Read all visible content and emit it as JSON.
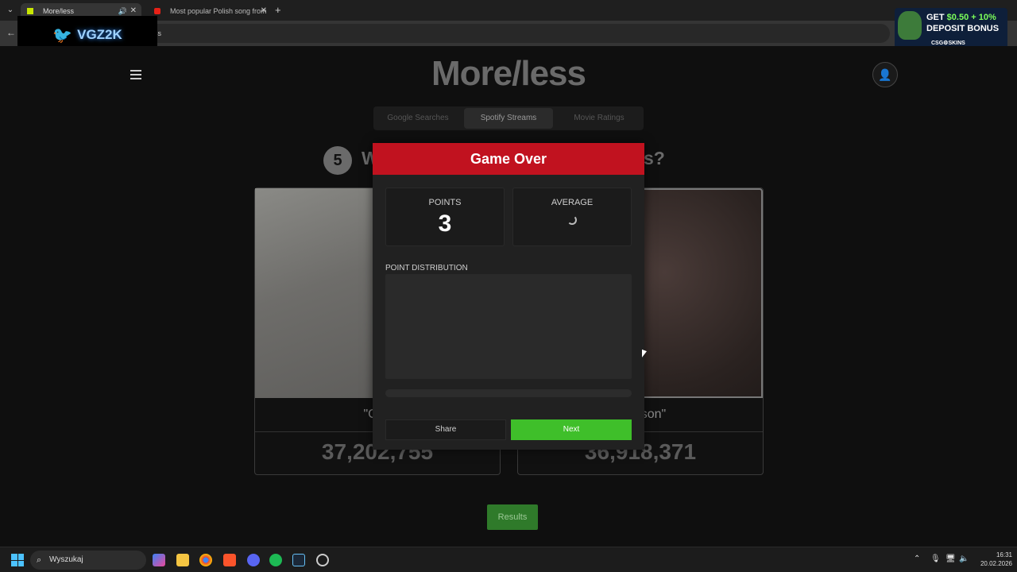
{
  "browser": {
    "tabs": [
      {
        "title": "More/less",
        "active": true
      },
      {
        "title": "Most popular Polish song from",
        "active": false
      }
    ],
    "new_tab": "+",
    "address": "ss"
  },
  "overlay": {
    "webcam_name": "VGZ2K",
    "ad": {
      "line1_prefix": "GET ",
      "line1_highlight": "$0.50 + 10%",
      "line2": "DEPOSIT BONUS",
      "brand": "CSG⚙SKINS"
    }
  },
  "site": {
    "title": "More/less",
    "categories": [
      {
        "label": "Google Searches",
        "active": false
      },
      {
        "label": "Spotify Streams",
        "active": true
      },
      {
        "label": "Movie Ratings",
        "active": false
      }
    ],
    "question_number": "5",
    "question_text_start": "W",
    "question_text_end": "ams?",
    "cards": {
      "left": {
        "name": "\"Cha",
        "value": "37,202,755"
      },
      "right": {
        "name": "Jackson\"",
        "value": "36,918,371"
      }
    },
    "results_label": "Results"
  },
  "modal": {
    "title": "Game Over",
    "points_label": "POINTS",
    "points_value": "3",
    "average_label": "AVERAGE",
    "distribution_label": "POINT DISTRIBUTION",
    "share_label": "Share",
    "next_label": "Next"
  },
  "taskbar": {
    "search_placeholder": "Wyszukaj",
    "time": "16:31",
    "date": "20.02.2026"
  },
  "colors": {
    "modal_header": "#c1121f",
    "next_button": "#3fbf2a",
    "results_button": "#2f7a2a"
  }
}
